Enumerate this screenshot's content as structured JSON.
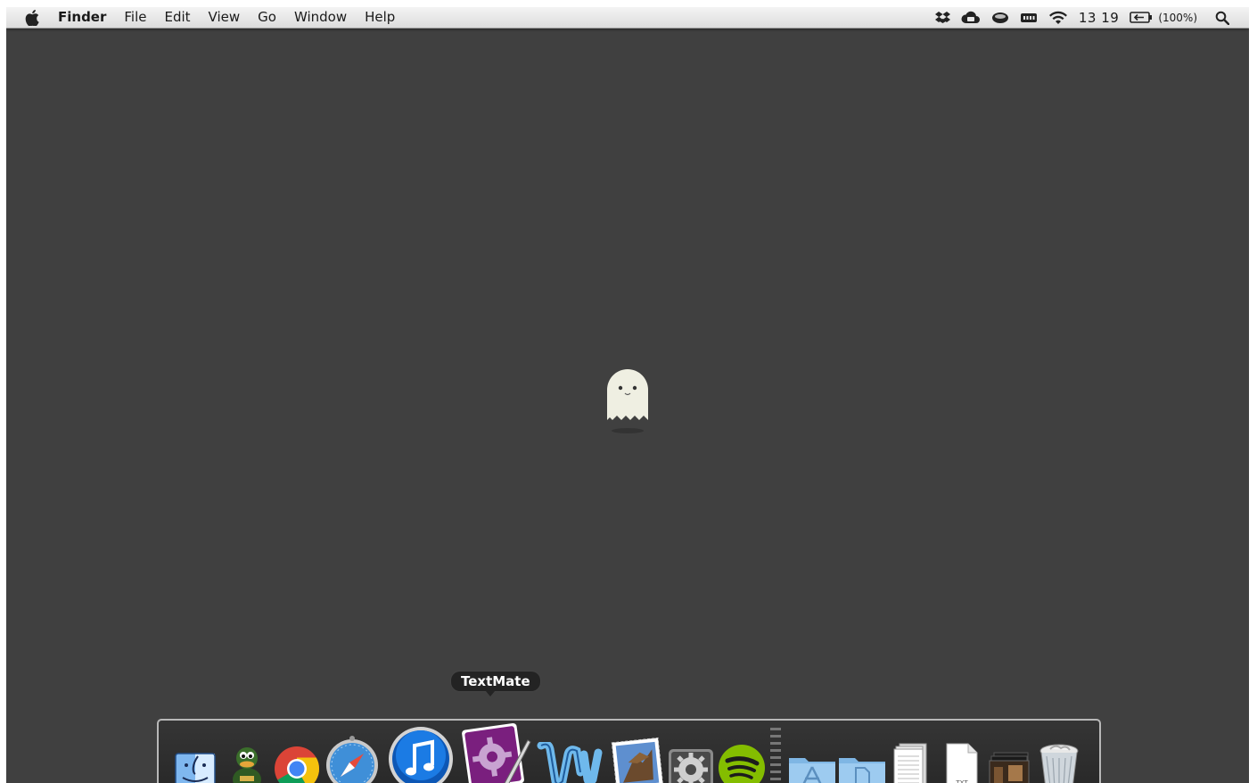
{
  "menubar": {
    "app_name": "Finder",
    "menus": [
      "File",
      "Edit",
      "View",
      "Go",
      "Window",
      "Help"
    ],
    "status": {
      "clock": "13 19",
      "battery": "(100%)",
      "icons": [
        "dropbox-icon",
        "cloud-icon",
        "caffeine-icon",
        "memory-icon",
        "wifi-icon",
        "battery-icon",
        "spotlight-icon"
      ]
    }
  },
  "desktop": {
    "center_icon": "ghost-icon",
    "background_color": "#404040"
  },
  "dock": {
    "tooltip": "TextMate",
    "items": [
      {
        "name": "finder",
        "running": true
      },
      {
        "name": "adium",
        "running": true
      },
      {
        "name": "chrome",
        "running": true
      },
      {
        "name": "safari",
        "running": false
      },
      {
        "name": "itunes",
        "running": false
      },
      {
        "name": "textmate",
        "running": false
      },
      {
        "name": "word",
        "running": true
      },
      {
        "name": "mail",
        "running": true
      },
      {
        "name": "system-preferences",
        "running": false
      },
      {
        "name": "spotify",
        "running": false
      },
      {
        "name": "applications-folder",
        "running": false
      },
      {
        "name": "documents-folder",
        "running": false
      },
      {
        "name": "downloads-stack",
        "running": false
      },
      {
        "name": "txt-file",
        "running": false
      },
      {
        "name": "pictures-stack",
        "running": false
      },
      {
        "name": "trash",
        "running": false
      }
    ]
  },
  "colors": {
    "desktop": "#404040",
    "menubar": "#e8e8e8",
    "running_dot": "#c9e6ff"
  }
}
